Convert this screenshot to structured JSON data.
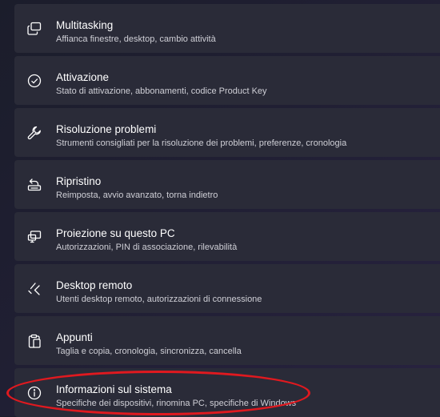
{
  "settings_items": [
    {
      "icon": "multitasking-icon",
      "title": "Multitasking",
      "subtitle": "Affianca finestre, desktop, cambio attività"
    },
    {
      "icon": "activation-check-icon",
      "title": "Attivazione",
      "subtitle": "Stato di attivazione, abbonamenti, codice Product Key"
    },
    {
      "icon": "wrench-icon",
      "title": "Risoluzione problemi",
      "subtitle": "Strumenti consigliati per la risoluzione dei problemi, preferenze, cronologia"
    },
    {
      "icon": "recovery-icon",
      "title": "Ripristino",
      "subtitle": "Reimposta, avvio avanzato, torna indietro"
    },
    {
      "icon": "projection-icon",
      "title": "Proiezione su questo PC",
      "subtitle": "Autorizzazioni, PIN di associazione, rilevabilità"
    },
    {
      "icon": "remote-desktop-icon",
      "title": "Desktop remoto",
      "subtitle": "Utenti desktop remoto, autorizzazioni di connessione"
    },
    {
      "icon": "clipboard-icon",
      "title": "Appunti",
      "subtitle": "Taglia e copia, cronologia, sincronizza, cancella"
    },
    {
      "icon": "info-icon",
      "title": "Informazioni sul sistema",
      "subtitle": "Specifiche dei dispositivi, rinomina PC, specifiche di Windows"
    }
  ],
  "annotation": {
    "highlight_color": "#e0191f"
  },
  "colors": {
    "card_bg": "#2a2b38",
    "title": "#ffffff",
    "subtitle": "#cfcfd6"
  }
}
